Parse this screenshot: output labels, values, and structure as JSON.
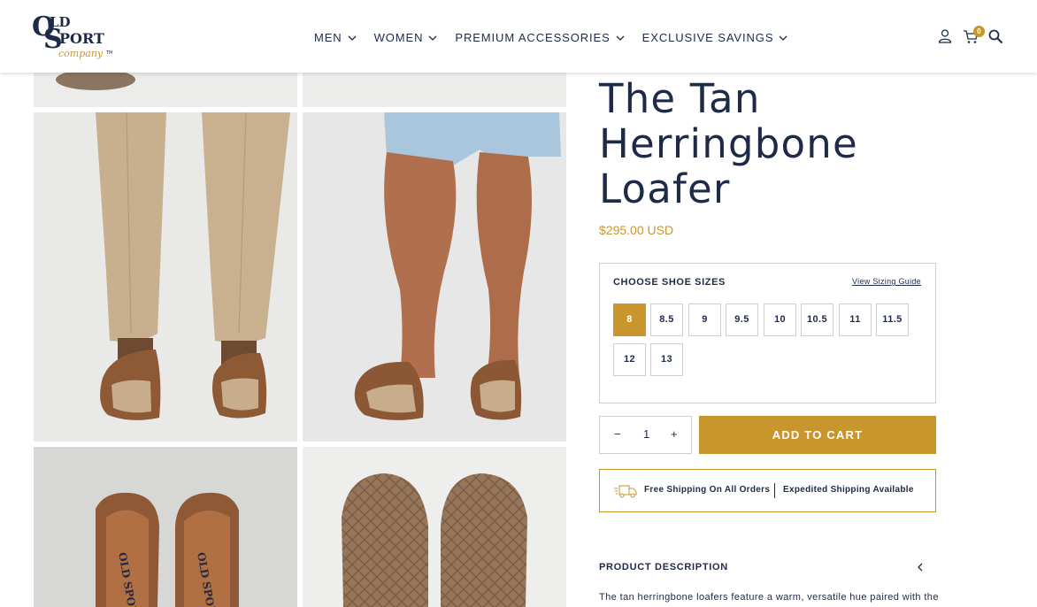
{
  "header": {
    "logo_text": "OLD SPORT company",
    "nav": [
      {
        "label": "MEN"
      },
      {
        "label": "WOMEN"
      },
      {
        "label": "PREMIUM ACCESSORIES"
      },
      {
        "label": "EXCLUSIVE SAVINGS"
      }
    ],
    "icons": [
      "account-icon",
      "cart-icon",
      "search-icon"
    ],
    "cart_count": "0"
  },
  "gallery": {
    "images": [
      "top-partial-1",
      "top-partial-2",
      "khaki-pants-loafers",
      "shorts-loafers",
      "loafers-top-view",
      "loafers-soles"
    ]
  },
  "product": {
    "title": "The Tan Herringbone Loafer",
    "price": "$295.00 USD",
    "sizes_label": "CHOOSE SHOE SIZES",
    "size_guide": "View Sizing Guide",
    "sizes": [
      "8",
      "8.5",
      "9",
      "9.5",
      "10",
      "10.5",
      "11",
      "11.5",
      "12",
      "13"
    ],
    "selected_size": "8",
    "quantity": "1",
    "qty_minus": "−",
    "qty_plus": "+",
    "add_to_cart": "ADD TO CART",
    "shipping_1": "Free Shipping On All Orders",
    "shipping_2": "Expedited Shipping Available",
    "description_heading": "PRODUCT DESCRIPTION",
    "description_text": "The tan herringbone loafers feature a warm, versatile hue paired with the"
  },
  "colors": {
    "navy": "#1d2a48",
    "gold": "#c9962d",
    "border": "#cfcfcf"
  }
}
